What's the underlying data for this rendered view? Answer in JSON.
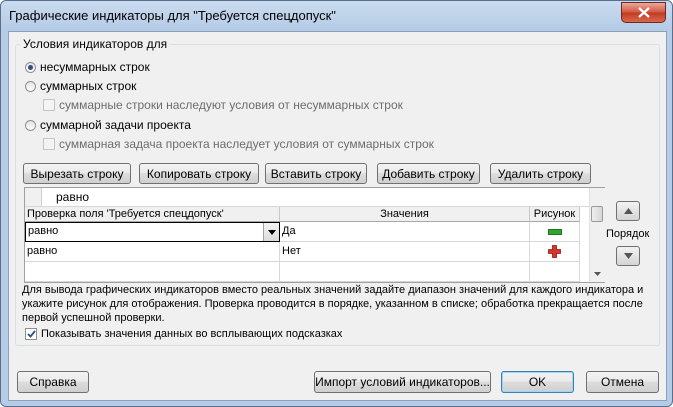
{
  "window": {
    "title": "Графические индикаторы для \"Требуется спецдопуск\""
  },
  "conditions": {
    "legend": "Условия индикаторов для",
    "nonsummary_label": "несуммарных строк",
    "summary_label": "суммарных строк",
    "summary_inherit_label": "суммарные строки наследуют условия от несуммарных строк",
    "project_summary_label": "суммарной задачи проекта",
    "project_inherit_label": "суммарная задача проекта наследует условия от суммарных строк",
    "selected": "несуммарных строк"
  },
  "toolbar": {
    "cut_label": "Вырезать строку",
    "copy_label": "Копировать строку",
    "paste_label": "Вставить строку",
    "add_label": "Добавить строку",
    "delete_label": "Удалить строку"
  },
  "grid": {
    "edit_value": "равно",
    "columns": [
      "Проверка поля 'Требуется спецдопуск'",
      "Значения",
      "Рисунок"
    ],
    "rows": [
      {
        "test": "равно",
        "value": "Да",
        "image": "green-minus-icon"
      },
      {
        "test": "равно",
        "value": "Нет",
        "image": "red-plus-icon"
      }
    ]
  },
  "order": {
    "label": "Порядок"
  },
  "description": "Для вывода графических индикаторов вместо реальных значений задайте диапазон значений для каждого индикатора и укажите рисунок для отображения.  Проверка проводится в порядке, указанном в списке; обработка прекращается после первой успешной проверки.",
  "show_tooltips": {
    "label": "Показывать значения данных во всплывающих подсказках",
    "checked": true
  },
  "footer": {
    "help_label": "Справка",
    "import_label": "Импорт условий индикаторов...",
    "ok_label": "OK",
    "cancel_label": "Отмена"
  },
  "colors": {
    "indicator_green": "#2fa52f",
    "indicator_red": "#d9342b",
    "accent": "#3c7fb1"
  }
}
